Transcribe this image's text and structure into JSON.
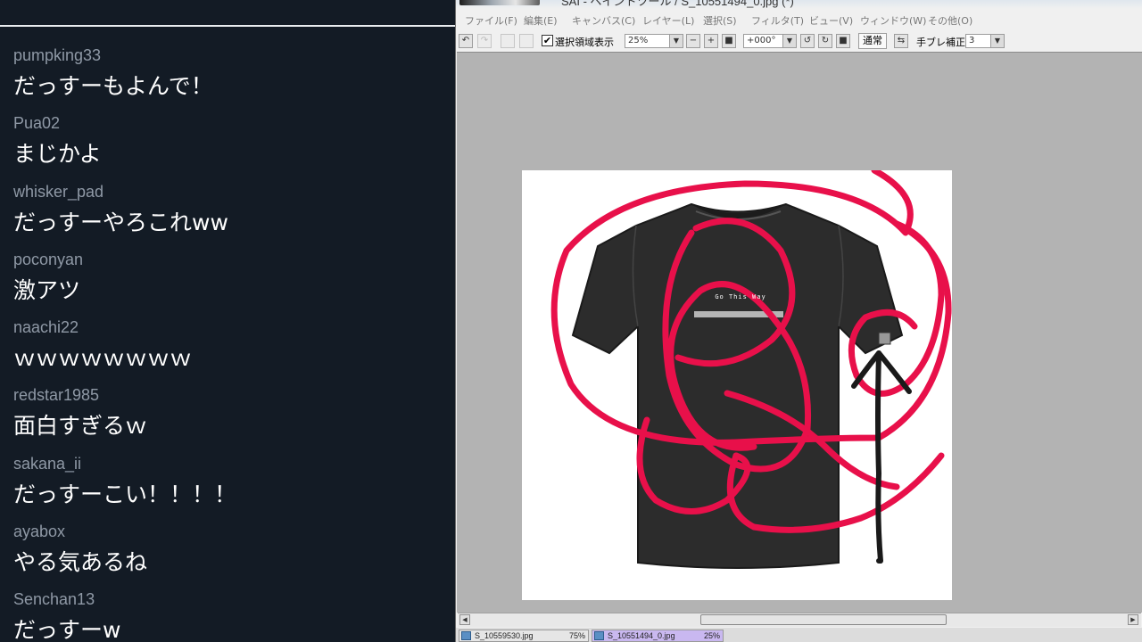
{
  "chat": {
    "messages": [
      {
        "user": "pumpking33",
        "text": "だっすーもよんで！"
      },
      {
        "user": "Pua02",
        "text": "まじかよ"
      },
      {
        "user": "whisker_pad",
        "text": "だっすーやろこれww"
      },
      {
        "user": "poconyan",
        "text": "激アツ"
      },
      {
        "user": "naachi22",
        "text": "ｗｗｗｗｗｗｗｗ"
      },
      {
        "user": "redstar1985",
        "text": "面白すぎるｗ"
      },
      {
        "user": "sakana_ii",
        "text": "だっすーこい！！！！"
      },
      {
        "user": "ayabox",
        "text": "やる気あるね"
      },
      {
        "user": "Senchan13",
        "text": "だっすーw"
      }
    ]
  },
  "sai": {
    "title": "SAI - ペイントツール / S_10551494_0.jpg (*)",
    "menu": [
      "ファイル(F)",
      "編集(E)",
      "キャンバス(C)",
      "レイヤー(L)",
      "選択(S)",
      "フィルタ(T)",
      "ビュー(V)",
      "ウィンドウ(W)",
      "その他(O)"
    ],
    "toolbar": {
      "selection_display_label": "選択領域表示",
      "zoom_value": "25%",
      "rotation_value": "+000°",
      "blend_mode": "通常",
      "stabilizer_label": "手ブレ補正",
      "stabilizer_value": "3"
    },
    "canvas": {
      "shirt_text": "Go This Way",
      "colors": {
        "background": "#b3b3b3",
        "shirt": "#2c2c2c",
        "scribble": "#e8104a",
        "arrow": "#1a1a1a"
      }
    },
    "file_tabs": [
      {
        "name": "S_10559530.jpg",
        "zoom": "75%"
      },
      {
        "name": "S_10551494_0.jpg",
        "zoom": "25%"
      }
    ]
  }
}
